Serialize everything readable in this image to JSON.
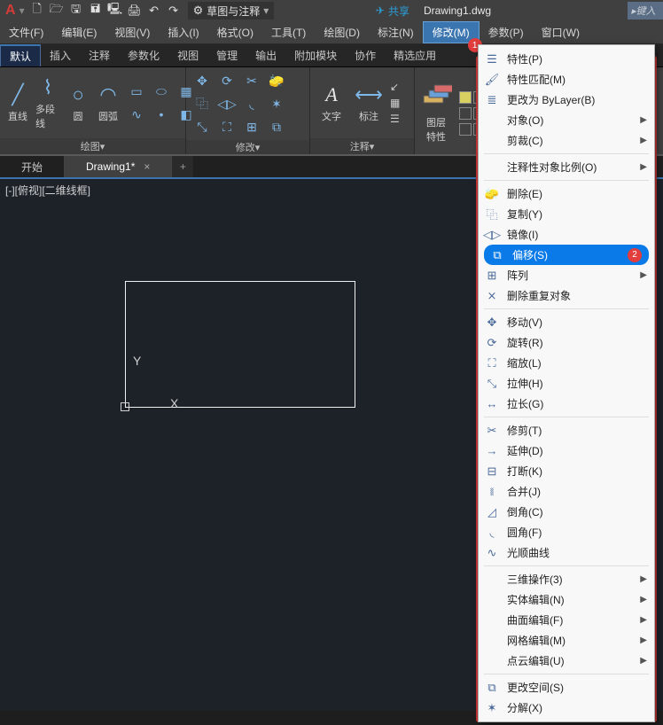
{
  "title": {
    "doc": "Drawing1.dwg",
    "share": "共享",
    "search": "键入",
    "workspace": "草图与注释"
  },
  "menubar": {
    "file": "文件(F)",
    "edit": "编辑(E)",
    "view": "视图(V)",
    "insert": "插入(I)",
    "format": "格式(O)",
    "tools": "工具(T)",
    "draw": "绘图(D)",
    "dimension": "标注(N)",
    "modify": "修改(M)",
    "param": "参数(P)",
    "window": "窗口(W)"
  },
  "ribbon_tabs": {
    "default": "默认",
    "insert": "插入",
    "annot": "注释",
    "param": "参数化",
    "view": "视图",
    "manage": "管理",
    "output": "输出",
    "addon": "附加模块",
    "collab": "协作",
    "feat": "精选应用"
  },
  "panels": {
    "draw": {
      "title": "绘图",
      "line": "直线",
      "polyline": "多段线",
      "circle": "圆",
      "arc": "圆弧"
    },
    "modify": {
      "title": "修改"
    },
    "annot": {
      "title": "注释",
      "text": "文字",
      "dim": "标注"
    },
    "layers": {
      "title": "图层",
      "prop": "图层\n特性"
    }
  },
  "tabs": {
    "start": "开始",
    "drawing1": "Drawing1*"
  },
  "viewport": {
    "label": "[-][俯视][二维线框]"
  },
  "badges": {
    "menu": "1",
    "offset": "2"
  },
  "dropdown": {
    "properties": "特性(P)",
    "matchprop": "特性匹配(M)",
    "bylayer": "更改为 ByLayer(B)",
    "object": "对象(O)",
    "clip": "剪裁(C)",
    "annoscale": "注释性对象比例(O)",
    "erase": "删除(E)",
    "copy": "复制(Y)",
    "mirror": "镜像(I)",
    "offset": "偏移(S)",
    "array": "阵列",
    "overkill": "删除重复对象",
    "move": "移动(V)",
    "rotate": "旋转(R)",
    "scale": "缩放(L)",
    "stretch": "拉伸(H)",
    "lengthen": "拉长(G)",
    "trim": "修剪(T)",
    "extend": "延伸(D)",
    "break": "打断(K)",
    "join": "合并(J)",
    "chamfer": "倒角(C)",
    "fillet": "圆角(F)",
    "blend": "光顺曲线",
    "3dops": "三维操作(3)",
    "solidedit": "实体编辑(N)",
    "surfedit": "曲面编辑(F)",
    "meshedit": "网格编辑(M)",
    "pcedit": "点云编辑(U)",
    "chspace": "更改空间(S)",
    "explode": "分解(X)"
  }
}
